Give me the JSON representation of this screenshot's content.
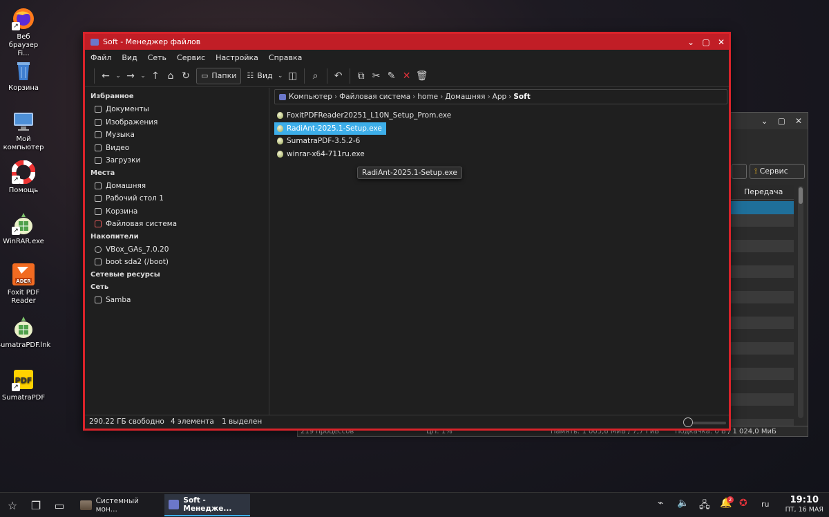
{
  "desktop": {
    "icons": [
      {
        "label": "Веб браузер Fi...",
        "icon": "firefox-icon"
      },
      {
        "label": "Корзина",
        "icon": "trash-icon"
      },
      {
        "label": "Мой компьютер",
        "icon": "computer-icon"
      },
      {
        "label": "Помощь",
        "icon": "help-icon"
      },
      {
        "label": "WinRAR.exe",
        "icon": "winrar-icon"
      },
      {
        "label": "Foxit PDF Reader",
        "icon": "foxit-icon"
      },
      {
        "label": "SumatraPDF.lnk",
        "icon": "sumatra-link-icon"
      },
      {
        "label": "SumatraPDF",
        "icon": "sumatra-icon"
      }
    ]
  },
  "background_window": {
    "combo_label": "Сервис",
    "column_header": "Передача",
    "status_processes": "219 процессов",
    "status_cpu": "ЦП: 1%",
    "status_memory": "Память: 1 005,6 МиБ / 7,7 ГиБ",
    "status_swap": "Подкачка: 0 Б / 1 024,0 МиБ"
  },
  "window": {
    "title": "Soft - Менеджер файлов",
    "menu": [
      "Файл",
      "Вид",
      "Сеть",
      "Сервис",
      "Настройка",
      "Справка"
    ],
    "toolbar": {
      "folders_label": "Папки",
      "view_label": "Вид"
    },
    "sidebar": {
      "sections": [
        {
          "title": "Избранное",
          "items": [
            "Документы",
            "Изображения",
            "Музыка",
            "Видео",
            "Загрузки"
          ]
        },
        {
          "title": "Места",
          "items": [
            "Домашняя",
            "Рабочий стол 1",
            "Корзина",
            "Файловая система"
          ]
        },
        {
          "title": "Накопители",
          "items": [
            "VBox_GAs_7.0.20",
            "boot sda2 (/boot)"
          ]
        },
        {
          "title": "Сетевые ресурсы",
          "items": []
        },
        {
          "title": "Сеть",
          "items": [
            "Samba"
          ]
        }
      ]
    },
    "breadcrumb": [
      "Компьютер",
      "Файловая система",
      "home",
      "Домашняя",
      "App",
      "Soft"
    ],
    "files": [
      {
        "name": "FoxitPDFReader20251_L10N_Setup_Prom.exe",
        "selected": false
      },
      {
        "name": "RadiAnt-2025.1-Setup.exe",
        "selected": true
      },
      {
        "name": "SumatraPDF-3.5.2-6",
        "selected": false
      },
      {
        "name": "winrar-x64-711ru.exe",
        "selected": false
      }
    ],
    "tooltip": "RadiAnt-2025.1-Setup.exe",
    "status": {
      "free": "290.22 ГБ свободно",
      "count": "4 элемента",
      "selected": "1 выделен"
    }
  },
  "taskbar": {
    "tasks": [
      {
        "label": "Системный мон...",
        "active": false
      },
      {
        "label": "Soft - Менедже...",
        "active": true
      }
    ],
    "language": "ru",
    "notification_count": "2",
    "time": "19:10",
    "date": "ПТ, 16 МАЯ"
  },
  "colors": {
    "accent": "#3daee9",
    "window_border": "#d9232a",
    "title_bg": "#c11e26"
  }
}
